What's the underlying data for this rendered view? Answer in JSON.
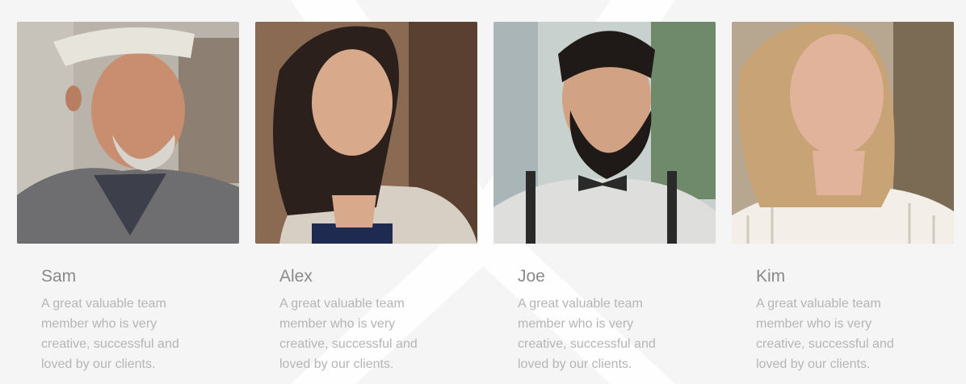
{
  "team": {
    "members": [
      {
        "name": "Sam",
        "bio": "A great valuable team member who is very creative, successful and loved by our clients.",
        "photo_icon": "portrait-photo",
        "colors": {
          "bg": "#b9b3aa",
          "bg2": "#8d7f72",
          "skin": "#c98e70",
          "hair": "#d8d5ce",
          "shirt": "#6e6e70",
          "accent": "#e7e4db"
        }
      },
      {
        "name": "Alex",
        "bio": "A great valuable team member who is very creative, successful and loved by our clients.",
        "photo_icon": "portrait-photo",
        "colors": {
          "bg": "#8a6a52",
          "bg2": "#5a4030",
          "skin": "#d9a98c",
          "hair": "#2b201b",
          "shirt": "#d8cfc4",
          "accent": "#1f2a50"
        }
      },
      {
        "name": "Joe",
        "bio": "A great valuable team member who is very creative, successful and loved by our clients.",
        "photo_icon": "portrait-photo",
        "colors": {
          "bg": "#c9d1cf",
          "bg2": "#6f8a6a",
          "skin": "#d1a283",
          "hair": "#1f1a17",
          "shirt": "#dedfdc",
          "accent": "#2a2a2a"
        }
      },
      {
        "name": "Kim",
        "bio": "A great valuable team member who is very creative, successful and loved by our clients.",
        "photo_icon": "portrait-photo",
        "colors": {
          "bg": "#b7a791",
          "bg2": "#7b6b55",
          "skin": "#e0b39a",
          "hair": "#c7a376",
          "shirt": "#f3efe8",
          "accent": "#e9e4da"
        }
      }
    ]
  }
}
